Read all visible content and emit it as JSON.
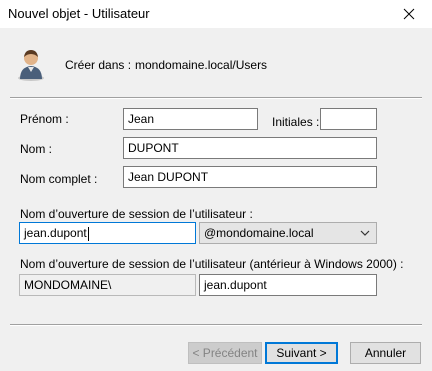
{
  "window": {
    "title": "Nouvel objet - Utilisateur",
    "close_icon": "close-icon"
  },
  "header": {
    "icon": "user-icon",
    "create_in_label": "Créer dans :",
    "create_in_path": "mondomaine.local/Users"
  },
  "form": {
    "first_name_label": "Prénom :",
    "first_name_value": "Jean",
    "initials_label": "Initiales :",
    "initials_value": "",
    "last_name_label": "Nom :",
    "last_name_value": "DUPONT",
    "full_name_label": "Nom complet :",
    "full_name_value": "Jean DUPONT",
    "logon_label": "Nom d’ouverture de session de l’utilisateur :",
    "logon_value": "jean.dupont",
    "domain_suffix_value": "@mondomaine.local",
    "legacy_logon_label": "Nom d’ouverture de session de l’utilisateur (antérieur à Windows 2000) :",
    "legacy_domain_value": "MONDOMAINE\\",
    "legacy_logon_value": "jean.dupont"
  },
  "buttons": {
    "back_label": "< Précédent",
    "next_label": "Suivant >",
    "cancel_label": "Annuler"
  },
  "colors": {
    "focus_accent": "#0078d7",
    "dialog_background": "#f0f0f0"
  }
}
